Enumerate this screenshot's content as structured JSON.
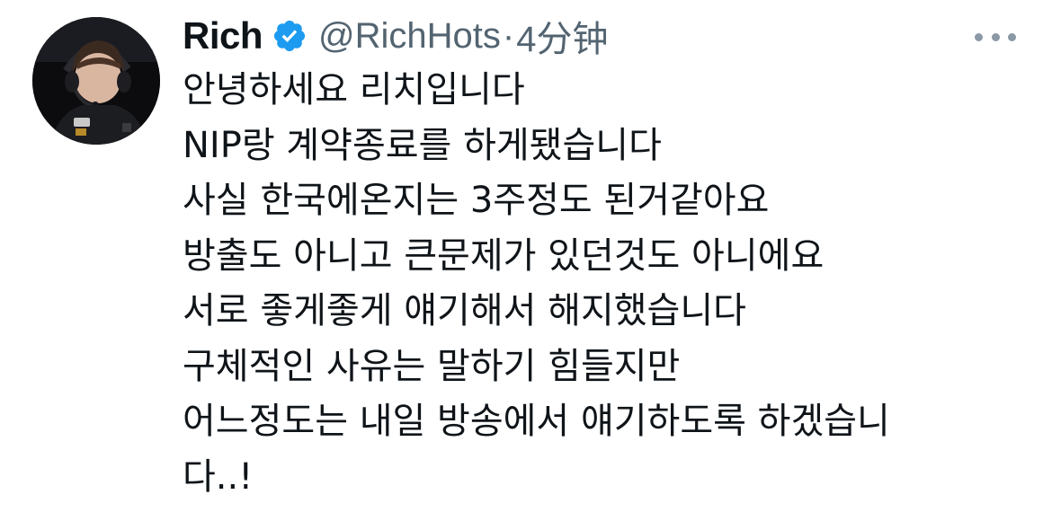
{
  "author": {
    "display_name": "Rich",
    "handle": "@RichHots",
    "separator": "·",
    "time": "4分钟",
    "verified": true
  },
  "icons": {
    "avatar": "profile-photo",
    "verified": "verified-badge-icon",
    "more": "more-options-icon"
  },
  "colors": {
    "verified_blue": "#1d9bf0",
    "text_primary": "#0f1419",
    "text_secondary": "#536471"
  },
  "tweet": {
    "lines": [
      "안녕하세요 리치입니다",
      "NIP랑 계약종료를 하게됐습니다",
      "사실 한국에온지는 3주정도 된거같아요",
      "방출도 아니고 큰문제가 있던것도 아니에요",
      "서로 좋게좋게 얘기해서 해지했습니다",
      "구체적인 사유는 말하기 힘들지만",
      "어느정도는 내일 방송에서 얘기하도록 하겠습니",
      "다..!"
    ]
  }
}
